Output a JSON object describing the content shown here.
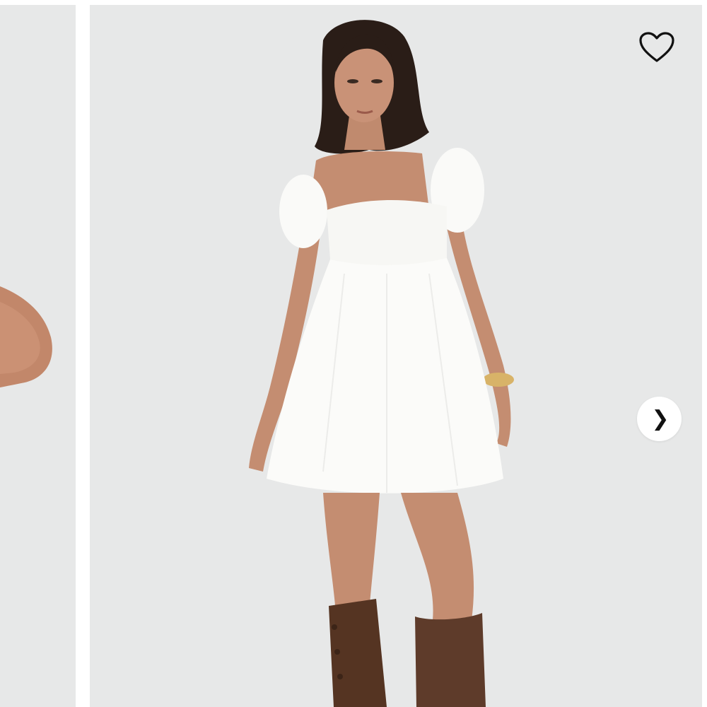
{
  "gallery": {
    "slides": [
      {
        "name": "previous-product-photo",
        "visible": "partial"
      },
      {
        "name": "current-product-photo",
        "visible": "full"
      }
    ],
    "controls": {
      "wishlist_icon": "heart-outline-icon",
      "next_icon": "chevron-right-icon",
      "next_glyph": "❯"
    }
  },
  "colors": {
    "photo_background": "#e7e8e8",
    "page_background": "#ffffff",
    "icon": "#111111",
    "dress": "#fbfbf9",
    "boots": "#5a3828",
    "skin": "#c89478",
    "hair": "#2a1d17"
  }
}
